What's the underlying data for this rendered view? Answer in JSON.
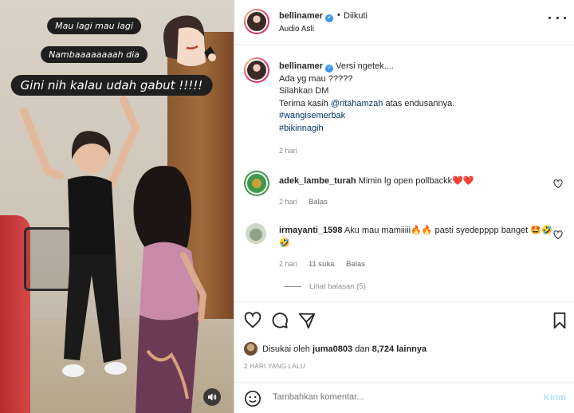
{
  "video": {
    "caption_line1": "Mau lagi mau lagi",
    "caption_line2": "Nambaaaaaaaah dia",
    "caption_line3": "Gini nih kalau udah gabut !!!!!",
    "mute_icon": "speaker-icon"
  },
  "header": {
    "username": "bellinamer",
    "separator": "•",
    "follow_status": "Diikuti",
    "audio_label": "Audio Asli"
  },
  "caption": {
    "username": "bellinamer",
    "line1": "Versi ngetek....",
    "line2": "Ada yg mau ?????",
    "line3": "Silahkan DM",
    "line4_prefix": "Terima kasih",
    "mention": "@ritahamzah",
    "line4_suffix": "atas endusannya.",
    "hashtag1": "#wangisemerbak",
    "hashtag2": "#bikinnagih",
    "time": "2 hari"
  },
  "comments": [
    {
      "username": "adek_lambe_turah",
      "text": "Mimin lg open pollbackk❤️❤️",
      "time": "2 hari",
      "reply_label": "Balas"
    },
    {
      "username": "irmayanti_1598",
      "text": "Aku mau mamiiiii🔥🔥 pasti syedepppp banget 🤩🤣🤣",
      "time": "2 hari",
      "likes": "11 suka",
      "reply_label": "Balas",
      "view_replies": "Lihat balasan (5)"
    }
  ],
  "actions": {
    "liked_by_prefix": "Disukai oleh",
    "liked_by_user": "juma0803",
    "liked_by_conj": "dan",
    "liked_by_count": "8,724 lainnya",
    "date": "2 HARI YANG LALU"
  },
  "composer": {
    "placeholder": "Tambahkan komentar...",
    "send_label": "Kirim"
  }
}
